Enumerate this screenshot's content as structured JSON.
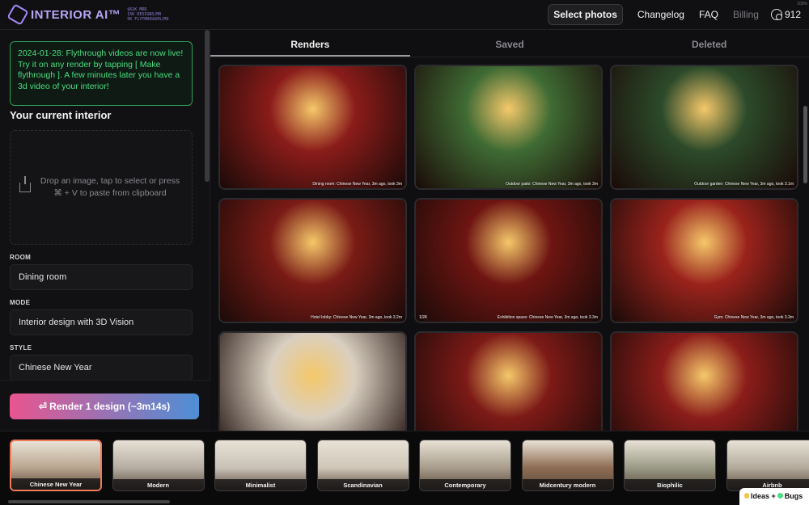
{
  "app": {
    "logo_text": "INTERIOR AI™",
    "logo_stats": [
      "$61K MRR",
      "15K DESIGNS/MO",
      "5K FLYTHROUGHS/MO"
    ],
    "zoom": "100%"
  },
  "nav": {
    "select_photos": "Select photos",
    "changelog": "Changelog",
    "faq": "FAQ",
    "billing": "Billing",
    "credits": "912"
  },
  "sidebar": {
    "announcement": "2024-01-28: Flythrough videos are now live! Try it on any render by tapping [ Make flythrough ]. A few minutes later you have a 3d video of your interior!",
    "section_title": "Your current interior",
    "drop_text": "Drop an image, tap to select or press ⌘ + V to paste from clipboard",
    "room_label": "ROOM",
    "room_value": "Dining room",
    "mode_label": "MODE",
    "mode_value": "Interior design with 3D Vision",
    "style_label": "STYLE",
    "style_value": "Chinese New Year",
    "render_button": "⏎ Render 1 design (~3m14s)"
  },
  "tabs": [
    {
      "label": "Renders",
      "active": true
    },
    {
      "label": "Saved",
      "active": false
    },
    {
      "label": "Deleted",
      "active": false
    }
  ],
  "renders": [
    {
      "caption": "Dining room: Chinese New Year, 3m ago, took 3m",
      "tone": "#8a1c1a"
    },
    {
      "caption": "Outdoor patio: Chinese New Year, 3m ago, took 3m",
      "tone": "#3f6b34"
    },
    {
      "caption": "Outdoor garden: Chinese New Year, 3m ago, took 3.1m",
      "tone": "#2c4a2a"
    },
    {
      "caption": "Hotel lobby: Chinese New Year, 3m ago, took 3.2m",
      "tone": "#7a1b16"
    },
    {
      "caption": "Exhibition space: Chinese New Year, 3m ago, took 3.3m",
      "tone": "#6e1512",
      "left": "1/2K"
    },
    {
      "caption": "Gym: Chinese New Year, 3m ago, took 3.3m",
      "tone": "#9a231c"
    },
    {
      "caption": "",
      "tone": "#d9cfc0"
    },
    {
      "caption": "",
      "tone": "#7d1a17"
    },
    {
      "caption": "",
      "tone": "#8b1d1a"
    }
  ],
  "styles": [
    {
      "label": "Chinese New Year",
      "active": true,
      "tone": "#b9a58e"
    },
    {
      "label": "Modern",
      "active": false,
      "tone": "#b6ada2"
    },
    {
      "label": "Minimalist",
      "active": false,
      "tone": "#c9c1b5"
    },
    {
      "label": "Scandinavian",
      "active": false,
      "tone": "#cfc6b8"
    },
    {
      "label": "Contemporary",
      "active": false,
      "tone": "#a89c8c"
    },
    {
      "label": "Midcentury modern",
      "active": false,
      "tone": "#8e6c52"
    },
    {
      "label": "Biophilic",
      "active": false,
      "tone": "#9a9a86"
    },
    {
      "label": "Airbnb",
      "active": false,
      "tone": "#b3aa9c"
    }
  ],
  "feedback": {
    "label_a": "Ideas +",
    "label_b": "Bugs"
  }
}
